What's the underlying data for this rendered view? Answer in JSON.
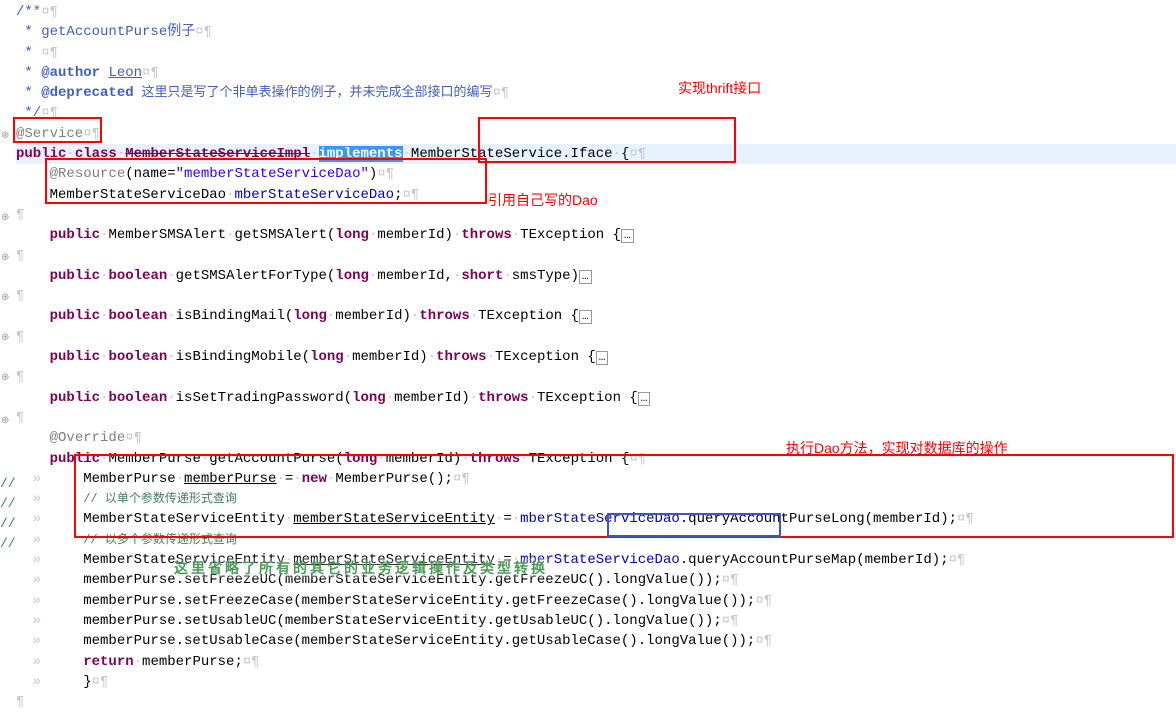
{
  "gutter": {
    "g1": "⊕",
    "g2": "⊕",
    "g3": "⊕",
    "g4": "⊕",
    "g5": "⊕",
    "g6": "⊕",
    "g7": "⊕"
  },
  "lines": {
    "l1": {
      "a": "/**",
      "ws": "¤¶"
    },
    "l2": {
      "a": " * ",
      "b": "getAccountPurse例子",
      "ws": "¤¶"
    },
    "l3": {
      "a": " * ",
      "ws": "¤¶"
    },
    "l4": {
      "a": " * ",
      "b": "@author",
      "c": " ",
      "d": "Leon",
      "ws": "¤¶"
    },
    "l5": {
      "a": " * ",
      "b": "@deprecated",
      "c": " 这里只是写了个非单表操作的例子，并未完成全部接口的编写",
      "ws": "¤¶"
    },
    "l6": {
      "a": " */",
      "ws": "¤¶"
    },
    "l7": {
      "a": "@Service",
      "ws": "¤¶"
    },
    "l8": {
      "a": "public",
      "sp": "·",
      "b": "class",
      "c": "MemberStateServiceImpl",
      "d": "implements",
      "e": "MemberStateService.Iface",
      "f": "{",
      "ws": "¤¶"
    },
    "l9": {
      "ind": "    ",
      "a": "@Resource",
      "b": "(name=",
      "c": "\"memberStateServiceDao\"",
      "d": ")",
      "ws": "¤¶"
    },
    "l10": {
      "ind": "    ",
      "a": "MemberStateServiceDao",
      "sp": "·",
      "b": "mberStateServiceDao",
      "c": ";",
      "ws": "¤¶"
    },
    "l11": {
      "ws": "¶"
    },
    "l12": {
      "ind": "    ",
      "a": "public",
      "sp": "·",
      "b": "MemberSMSAlert",
      "c": "getSMSAlert(",
      "d": "long",
      "e": "memberId)",
      "f": "throws",
      "g": "TException {",
      "fold": "…"
    },
    "l13": {
      "ws": "¶"
    },
    "l14": {
      "ind": "    ",
      "a": "public",
      "sp": "·",
      "b": "boolean",
      "c": "getSMSAlertForType(",
      "d": "long",
      "e": "memberId,",
      "f": "short",
      "g": "smsType)",
      "fold": "…"
    },
    "l15": {
      "ws": "¶"
    },
    "l16": {
      "ind": "    ",
      "a": "public",
      "sp": "·",
      "b": "boolean",
      "c": "isBindingMail(",
      "d": "long",
      "e": "memberId)",
      "f": "throws",
      "g": "TException {",
      "fold": "…"
    },
    "l17": {
      "ws": "¶"
    },
    "l18": {
      "ind": "    ",
      "a": "public",
      "sp": "·",
      "b": "boolean",
      "c": "isBindingMobile(",
      "d": "long",
      "e": "memberId)",
      "f": "throws",
      "g": "TException {",
      "fold": "…"
    },
    "l19": {
      "ws": "¶"
    },
    "l20": {
      "ind": "    ",
      "a": "public",
      "sp": "·",
      "b": "boolean",
      "c": "isSetTradingPassword(",
      "d": "long",
      "e": "memberId)",
      "f": "throws",
      "g": "TException {",
      "fold": "…"
    },
    "l21": {
      "ws": "¶"
    },
    "l22": {
      "ind": "    ",
      "a": "@Override",
      "ws": "¤¶"
    },
    "l23": {
      "ind": "    ",
      "a": "public",
      "sp": "·",
      "b": "MemberPurse",
      "c": "getAccountPurse(",
      "d": "long",
      "e": "memberId)",
      "f": "throws",
      "g": "TException {",
      "ws": "¤¶"
    },
    "l24": {
      "ind": "  »     ",
      "a": "MemberPurse",
      "sp": "·",
      "b": "memberPurse",
      "c": "=",
      "d": "new",
      "e": "MemberPurse();",
      "ws": "¤¶"
    },
    "l25": {
      "ind": "  »     ",
      "a": "// 以单个参数传递形式查询"
    },
    "l26": {
      "ind": "  »     ",
      "a": "MemberStateServiceEntity",
      "sp": "·",
      "b": "memberStateServiceEntity",
      "c": "=",
      "d": "mberStateServiceDao",
      "e": ".queryAccountPurseLong(memberId);",
      "ws": "¤¶"
    },
    "l27": {
      "ind": "  »     ",
      "a": "// 以多个参数传递形式查询"
    },
    "l28": {
      "ind": "  »     ",
      "a": "MemberStateServiceEntity",
      "sp": "·",
      "b": "memberStateServiceEntity",
      "c": "=",
      "d": "mberStateServiceDao",
      "e": ".queryAccountPurseMap(memberId);",
      "ws": "¤¶"
    },
    "l29": {
      "ind": "  »     ",
      "a": "memberPurse.setFreezeUC(memberStateServiceEntity.getFreezeUC().longValue());",
      "ws": "¤¶"
    },
    "l30": {
      "ind": "  »     ",
      "a": "memberPurse.setFreezeCase(memberStateServiceEntity.getFreezeCase().longValue());",
      "ws": "¤¶"
    },
    "l31": {
      "ind": "  »     ",
      "a": "memberPurse.setUsableUC(memberStateServiceEntity.getUsableUC().longValue());",
      "ws": "¤¶"
    },
    "l32": {
      "ind": "  »     ",
      "a": "memberPurse.setUsableCase(memberStateServiceEntity.getUsableCase().longValue());",
      "ws": "¤¶"
    },
    "l33": {
      "ind": "  »     ",
      "a": "return",
      "sp": "·",
      "b": "memberPurse;",
      "ws": "¤¶"
    },
    "l34": {
      "ind": "  »     ",
      "a": "}",
      "ws": "¤¶"
    },
    "l35": {
      "ws": "¶"
    }
  },
  "annotations": {
    "a1": "实现thrift接口",
    "a2": "引用自己写的Dao",
    "a3": "执行Dao方法，实现对数据库的操作",
    "a4": "这里省略了所有的其它的业务逻辑操作及类型转换"
  },
  "comment_prefix": "//"
}
